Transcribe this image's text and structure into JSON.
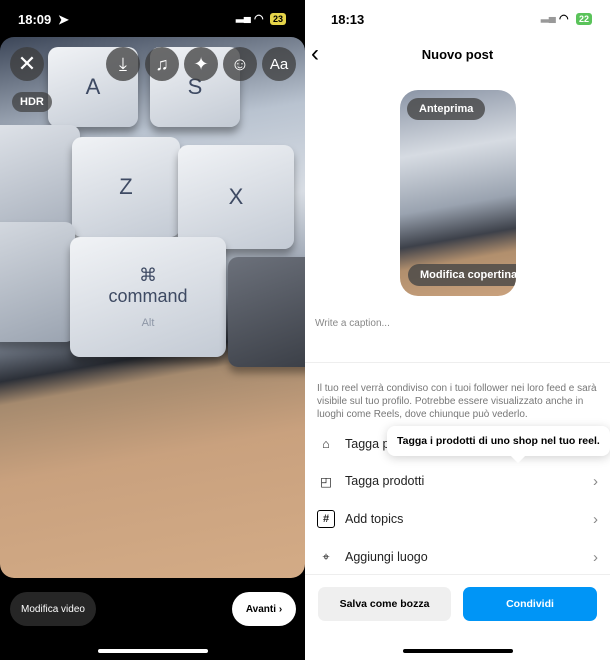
{
  "left": {
    "status": {
      "time": "18:09",
      "battery": "23"
    },
    "hdr": "HDR",
    "tools": [
      {
        "icon": "download-icon",
        "glyph": "⤓"
      },
      {
        "icon": "music-icon",
        "glyph": "♫"
      },
      {
        "icon": "sparkles-icon",
        "glyph": "✦"
      },
      {
        "icon": "sticker-icon",
        "glyph": "☺"
      },
      {
        "icon": "text-icon",
        "glyph": "Aa"
      }
    ],
    "keys": [
      "A",
      "S",
      "Z",
      "X",
      "⌘",
      "command",
      "Alt"
    ],
    "edit_video": "Modifica video",
    "next": "Avanti"
  },
  "right": {
    "status": {
      "time": "18:13",
      "battery": "22"
    },
    "title": "Nuovo post",
    "preview": "Anteprima",
    "edit_cover": "Modifica copertina",
    "caption_placeholder": "Write a caption...",
    "info": "Il tuo reel verrà condiviso con i tuoi follower nei loro feed e sarà visibile sul tuo profilo. Potrebbe essere visualizzato anche in luoghi come Reels, dove chiunque può vederlo.",
    "tooltip": "Tagga i prodotti di uno shop nel tuo reel.",
    "rows": [
      {
        "label": "Tagga persone",
        "icon": "tag-people-icon"
      },
      {
        "label": "Tagga prodotti",
        "icon": "shopping-bag-icon"
      },
      {
        "label": "Add topics",
        "icon": "hashtag-icon"
      },
      {
        "label": "Aggiungi luogo",
        "icon": "location-icon"
      }
    ],
    "save_draft": "Salva come bozza",
    "share": "Condividi",
    "accent": "#0095f6"
  }
}
